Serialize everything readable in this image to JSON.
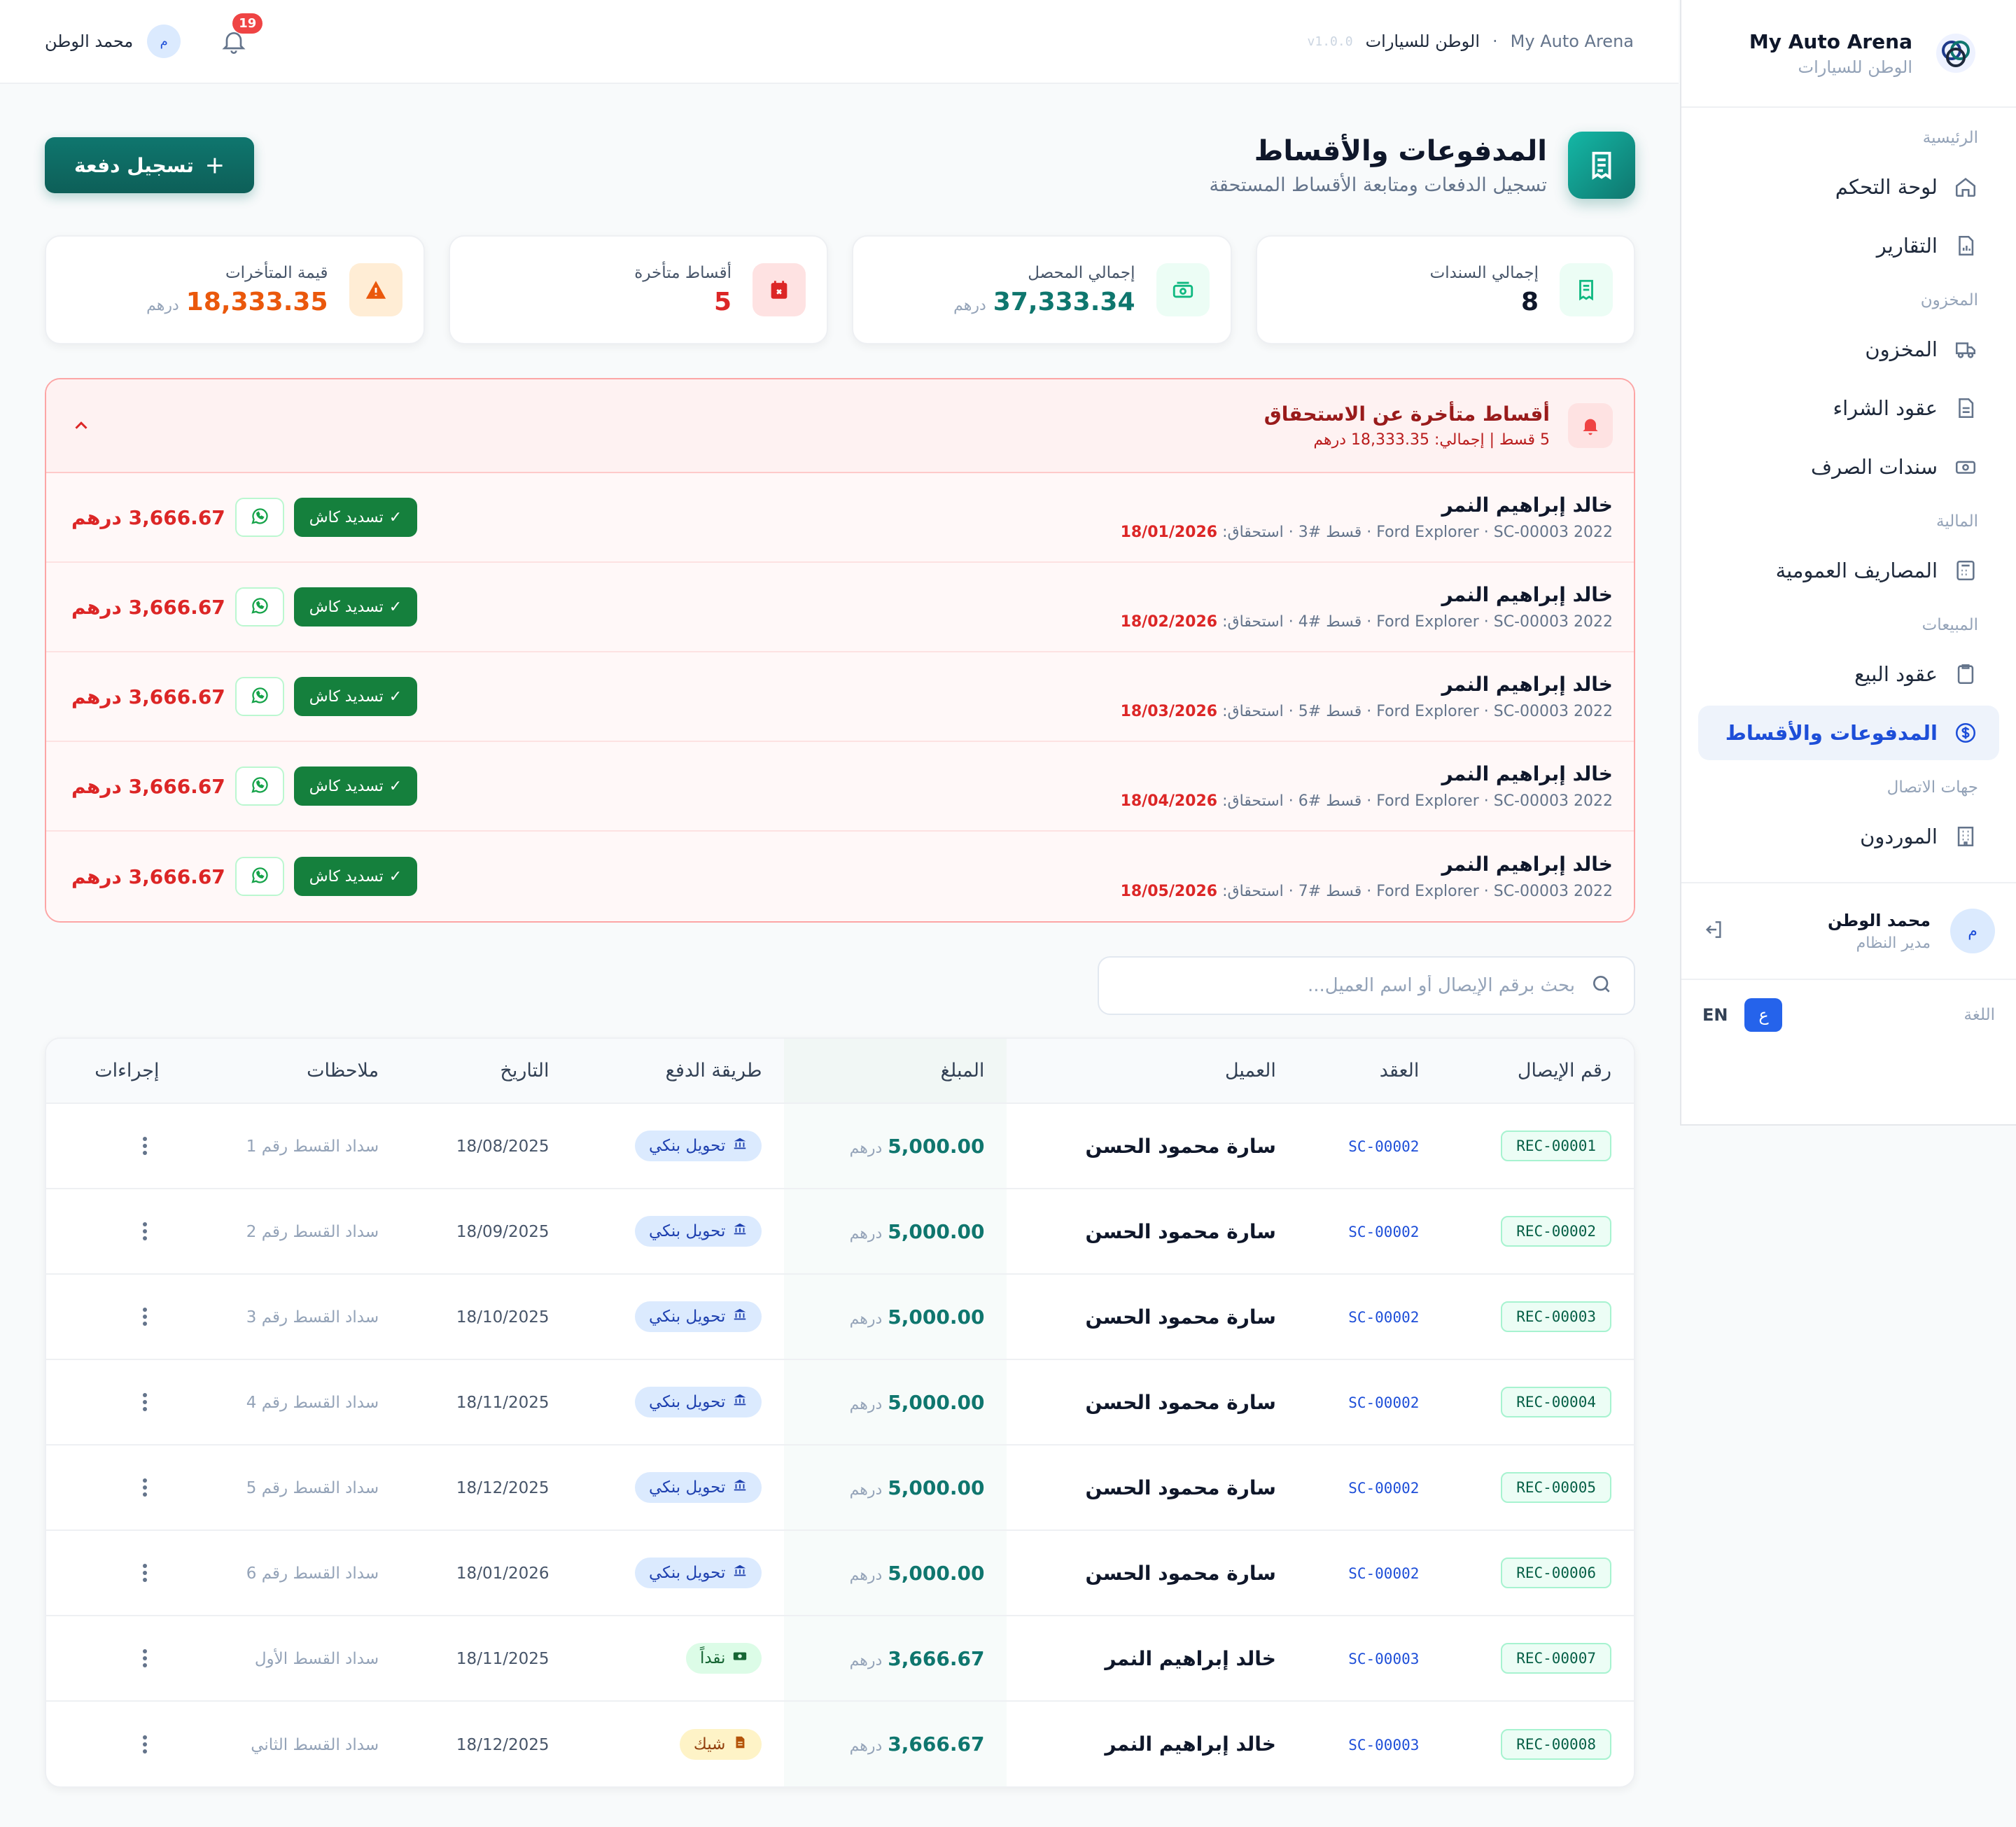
{
  "brand": {
    "name": "My Auto Arena",
    "sub": "الوطن للسيارات"
  },
  "nav": [
    {
      "section": "الرئيسية",
      "items": [
        {
          "label": "لوحة التحكم",
          "icon": "home-icon"
        },
        {
          "label": "التقارير",
          "icon": "report-icon"
        }
      ]
    },
    {
      "section": "المخزون",
      "items": [
        {
          "label": "المخزون",
          "icon": "truck-icon"
        },
        {
          "label": "عقود الشراء",
          "icon": "document-icon"
        },
        {
          "label": "سندات الصرف",
          "icon": "cash-icon"
        }
      ]
    },
    {
      "section": "المالية",
      "items": [
        {
          "label": "المصاريف العمومية",
          "icon": "calculator-icon"
        }
      ]
    },
    {
      "section": "المبيعات",
      "items": [
        {
          "label": "عقود البيع",
          "icon": "clipboard-icon"
        },
        {
          "label": "المدفوعات والأقساط",
          "icon": "dollar-circle-icon",
          "active": true
        }
      ]
    },
    {
      "section": "جهات الاتصال",
      "items": [
        {
          "label": "الموردون",
          "icon": "building-icon"
        }
      ]
    }
  ],
  "side_user": {
    "avatar": "م",
    "name": "محمد الوطن",
    "role": "مدير النظام"
  },
  "language": {
    "label": "اللغة",
    "ar": "ع",
    "en": "EN"
  },
  "topbar": {
    "crumb_root": "My Auto Arena",
    "crumb_sep": "·",
    "crumb_current": "الوطن للسيارات",
    "version": "v1.0.0",
    "notifications": "19",
    "user_name": "محمد الوطن",
    "user_avatar": "م"
  },
  "page": {
    "title": "المدفوعات والأقساط",
    "subtitle": "تسجيل الدفعات ومتابعة الأقساط المستحقة",
    "primary_button": "تسجيل دفعة"
  },
  "stats": [
    {
      "label": "إجمالي السندات",
      "value": "8",
      "unit": "",
      "color": "#0f172a",
      "icon": "receipt-icon",
      "icon_bg": "#ecfdf5",
      "icon_color": "#10b981"
    },
    {
      "label": "إجمالي المحصل",
      "value": "37,333.34",
      "unit": "درهم",
      "color": "#0f766e",
      "icon": "money-icon",
      "icon_bg": "#ecfdf5",
      "icon_color": "#10b981"
    },
    {
      "label": "أقساط متأخرة",
      "value": "5",
      "unit": "",
      "color": "#dc2626",
      "icon": "calendar-x-icon",
      "icon_bg": "#fee2e2",
      "icon_color": "#dc2626"
    },
    {
      "label": "قيمة المتأخرات",
      "value": "18,333.35",
      "unit": "درهم",
      "color": "#ea580c",
      "icon": "warning-icon",
      "icon_bg": "#ffedd5",
      "icon_color": "#ea580c"
    }
  ],
  "overdue": {
    "title": "أقساط متأخرة عن الاستحقاق",
    "summary": "5 قسط | إجمالي: 18,333.35 درهم",
    "whatsapp_label": "واتساب",
    "settle_label": "تسديد كاش",
    "items": [
      {
        "customer": "خالد إبراهيم النمر",
        "meta": "2022 Ford Explorer · SC-00003 · قسط #3 · استحقاق:",
        "due": "18/01/2026",
        "amount": "3,666.67 درهم"
      },
      {
        "customer": "خالد إبراهيم النمر",
        "meta": "2022 Ford Explorer · SC-00003 · قسط #4 · استحقاق:",
        "due": "18/02/2026",
        "amount": "3,666.67 درهم"
      },
      {
        "customer": "خالد إبراهيم النمر",
        "meta": "2022 Ford Explorer · SC-00003 · قسط #5 · استحقاق:",
        "due": "18/03/2026",
        "amount": "3,666.67 درهم"
      },
      {
        "customer": "خالد إبراهيم النمر",
        "meta": "2022 Ford Explorer · SC-00003 · قسط #6 · استحقاق:",
        "due": "18/04/2026",
        "amount": "3,666.67 درهم"
      },
      {
        "customer": "خالد إبراهيم النمر",
        "meta": "2022 Ford Explorer · SC-00003 · قسط #7 · استحقاق:",
        "due": "18/05/2026",
        "amount": "3,666.67 درهم"
      }
    ]
  },
  "search": {
    "placeholder": "بحث برقم الإيصال أو اسم العميل..."
  },
  "table": {
    "headers": [
      "رقم الإيصال",
      "العقد",
      "العميل",
      "المبلغ",
      "طريقة الدفع",
      "التاريخ",
      "ملاحظات",
      "إجراءات"
    ],
    "currency": "درهم",
    "rows": [
      {
        "receipt": "REC-00001",
        "contract": "SC-00002",
        "customer": "سارة محمود الحسن",
        "amount": "5,000.00",
        "method": "تحويل بنكي",
        "method_type": "bank",
        "date": "18/08/2025",
        "note": "سداد القسط رقم 1"
      },
      {
        "receipt": "REC-00002",
        "contract": "SC-00002",
        "customer": "سارة محمود الحسن",
        "amount": "5,000.00",
        "method": "تحويل بنكي",
        "method_type": "bank",
        "date": "18/09/2025",
        "note": "سداد القسط رقم 2"
      },
      {
        "receipt": "REC-00003",
        "contract": "SC-00002",
        "customer": "سارة محمود الحسن",
        "amount": "5,000.00",
        "method": "تحويل بنكي",
        "method_type": "bank",
        "date": "18/10/2025",
        "note": "سداد القسط رقم 3"
      },
      {
        "receipt": "REC-00004",
        "contract": "SC-00002",
        "customer": "سارة محمود الحسن",
        "amount": "5,000.00",
        "method": "تحويل بنكي",
        "method_type": "bank",
        "date": "18/11/2025",
        "note": "سداد القسط رقم 4"
      },
      {
        "receipt": "REC-00005",
        "contract": "SC-00002",
        "customer": "سارة محمود الحسن",
        "amount": "5,000.00",
        "method": "تحويل بنكي",
        "method_type": "bank",
        "date": "18/12/2025",
        "note": "سداد القسط رقم 5"
      },
      {
        "receipt": "REC-00006",
        "contract": "SC-00002",
        "customer": "سارة محمود الحسن",
        "amount": "5,000.00",
        "method": "تحويل بنكي",
        "method_type": "bank",
        "date": "18/01/2026",
        "note": "سداد القسط رقم 6"
      },
      {
        "receipt": "REC-00007",
        "contract": "SC-00003",
        "customer": "خالد إبراهيم النمر",
        "amount": "3,666.67",
        "method": "نقداً",
        "method_type": "cash",
        "date": "18/11/2025",
        "note": "سداد القسط الأول"
      },
      {
        "receipt": "REC-00008",
        "contract": "SC-00003",
        "customer": "خالد إبراهيم النمر",
        "amount": "3,666.67",
        "method": "شيك",
        "method_type": "check",
        "date": "18/12/2025",
        "note": "سداد القسط الثاني"
      }
    ]
  }
}
